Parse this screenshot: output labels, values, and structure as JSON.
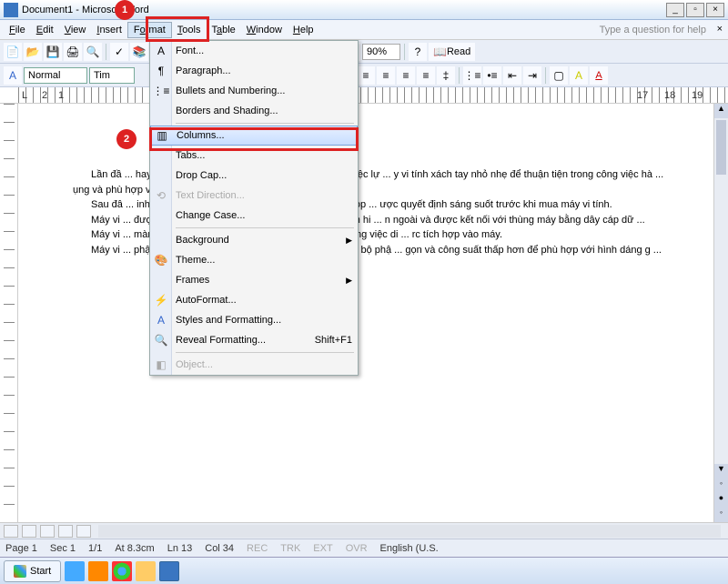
{
  "window": {
    "title": "Document1 - Microsoft Word"
  },
  "menubar": {
    "file": "File",
    "edit": "Edit",
    "view": "View",
    "insert": "Insert",
    "format": "Format",
    "tools": "Tools",
    "table": "Table",
    "window": "Window",
    "help": "Help",
    "helpbox": "Type a question for help"
  },
  "toolbar": {
    "style_label": "Normal",
    "font_label": "Tim",
    "zoom": "90%",
    "read": "Read"
  },
  "format_menu": {
    "font": "Font...",
    "paragraph": "Paragraph...",
    "bullets": "Bullets and Numbering...",
    "borders": "Borders and Shading...",
    "columns": "Columns...",
    "tabs": "Tabs...",
    "dropcap": "Drop Cap...",
    "textdir": "Text Direction...",
    "changecase": "Change Case...",
    "background": "Background",
    "theme": "Theme...",
    "frames": "Frames",
    "autoformat": "AutoFormat...",
    "styles": "Styles and Formatting...",
    "reveal": "Reveal Formatting...",
    "reveal_shortcut": "Shift+F1",
    "object": "Object..."
  },
  "document": {
    "p1": "Lần đầ ... hay vi tính thì không ít người luôn băn khoăn về việc lự ... y vi tính xách tay nhỏ nhẹ để thuận tiện trong công việc hà ... ụng và phù hợp với mọi người.",
    "p2": "Sau đâ ... inh để bàn (desktop) và máy vi tính xách tay (laptop ... ược quyết định sáng suốt trước khi mua máy vi tính.",
    "p3": "Máy vi ... được đặt cố định tại một vị trí, các thiết bị như màn hi ... n ngoài và được kết nối với thùng máy bằng dây cáp dữ ...",
    "p4": "Máy vi ... màn hình mỏng và xếp lại được nên thuận tiện trong việc di ... rc tích hợp vào máy.",
    "p5": "Máy vi ... phận với các chức năng giống nhau, tuy nhiên các bộ phậ ... gọn và công suất thấp hơn để phù hợp với hình dáng g ..."
  },
  "status": {
    "page": "Page 1",
    "sec": "Sec 1",
    "pages": "1/1",
    "at": "At 8.3cm",
    "ln": "Ln 13",
    "col": "Col 34",
    "rec": "REC",
    "trk": "TRK",
    "ext": "EXT",
    "ovr": "OVR",
    "lang": "English (U.S."
  },
  "taskbar": {
    "start": "Start"
  },
  "annotations": {
    "badge1": "1",
    "badge2": "2"
  }
}
